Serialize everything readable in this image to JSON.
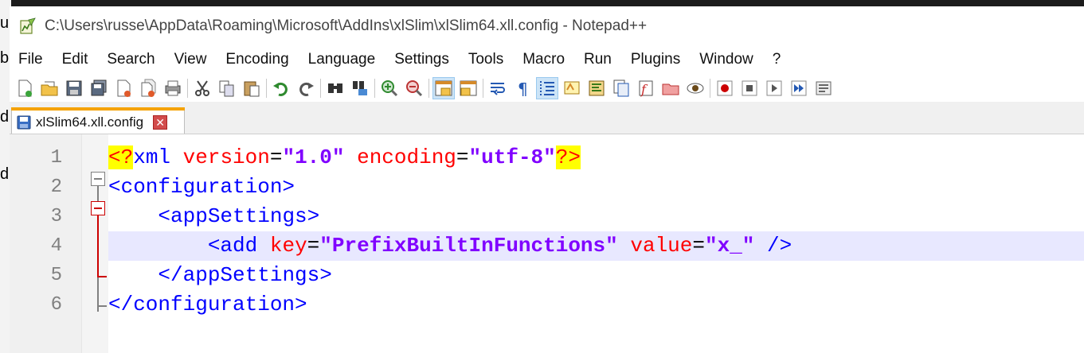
{
  "window": {
    "title": "C:\\Users\\russe\\AppData\\Roaming\\Microsoft\\AddIns\\xlSlim\\xlSlim64.xll.config - Notepad++"
  },
  "background_glyphs": [
    "u",
    "b",
    "d",
    "d"
  ],
  "menu": [
    "File",
    "Edit",
    "Search",
    "View",
    "Encoding",
    "Language",
    "Settings",
    "Tools",
    "Macro",
    "Run",
    "Plugins",
    "Window",
    "?"
  ],
  "toolbar": {
    "buttons": [
      "new-file-icon",
      "open-file-icon",
      "save-icon",
      "save-all-icon",
      "close-icon",
      "close-all-icon",
      "print-icon",
      "cut-icon",
      "copy-icon",
      "paste-icon",
      "undo-icon",
      "redo-icon",
      "find-icon",
      "replace-icon",
      "zoom-in-icon",
      "zoom-out-icon",
      "sync-vertical-icon",
      "sync-horizontal-icon",
      "word-wrap-icon",
      "show-all-chars-icon",
      "indent-guide-icon",
      "udl-icon",
      "doc-map-icon",
      "doc-list-icon",
      "function-list-icon",
      "folder-workspace-icon",
      "monitoring-icon",
      "record-macro-icon",
      "stop-macro-icon",
      "play-macro-icon",
      "play-multiple-icon",
      "save-macro-icon"
    ],
    "colors": {
      "accent_tab": "#f5a200",
      "pressed_bg": "#cce4f7"
    }
  },
  "tab": {
    "label": "xlSlim64.xll.config",
    "close_glyph": "✕"
  },
  "editor": {
    "current_line": 4,
    "lines": [
      {
        "number": "1",
        "tokens": [
          [
            "pi",
            "<?"
          ],
          [
            "xml",
            "xml"
          ],
          [
            "plain",
            " "
          ],
          [
            "attr",
            "version"
          ],
          [
            "eq",
            "="
          ],
          [
            "str",
            "\"1.0\""
          ],
          [
            "plain",
            " "
          ],
          [
            "attr",
            "encoding"
          ],
          [
            "eq",
            "="
          ],
          [
            "str",
            "\"utf-8\""
          ],
          [
            "pi",
            "?>"
          ]
        ]
      },
      {
        "number": "2",
        "tokens": [
          [
            "tag",
            "<configuration>"
          ]
        ]
      },
      {
        "number": "3",
        "tokens": [
          [
            "plain",
            "    "
          ],
          [
            "tag",
            "<appSettings>"
          ]
        ]
      },
      {
        "number": "4",
        "tokens": [
          [
            "plain",
            "        "
          ],
          [
            "tag",
            "<add"
          ],
          [
            "plain",
            " "
          ],
          [
            "attr",
            "key"
          ],
          [
            "eq",
            "="
          ],
          [
            "str",
            "\"PrefixBuiltInFunctions\""
          ],
          [
            "plain",
            " "
          ],
          [
            "attr",
            "value"
          ],
          [
            "eq",
            "="
          ],
          [
            "str",
            "\"x_\""
          ],
          [
            "plain",
            " "
          ],
          [
            "tag",
            "/>"
          ]
        ]
      },
      {
        "number": "5",
        "tokens": [
          [
            "plain",
            "    "
          ],
          [
            "tag",
            "</appSettings>"
          ]
        ]
      },
      {
        "number": "6",
        "tokens": [
          [
            "tag",
            "</configuration>"
          ]
        ]
      }
    ],
    "syntax_colors": {
      "pi_fg": "#ff0000",
      "pi_bg": "#ffff00",
      "tag": "#0000ff",
      "attr": "#ff0000",
      "string": "#8000ff",
      "current_line_bg": "#e8e8ff"
    }
  }
}
